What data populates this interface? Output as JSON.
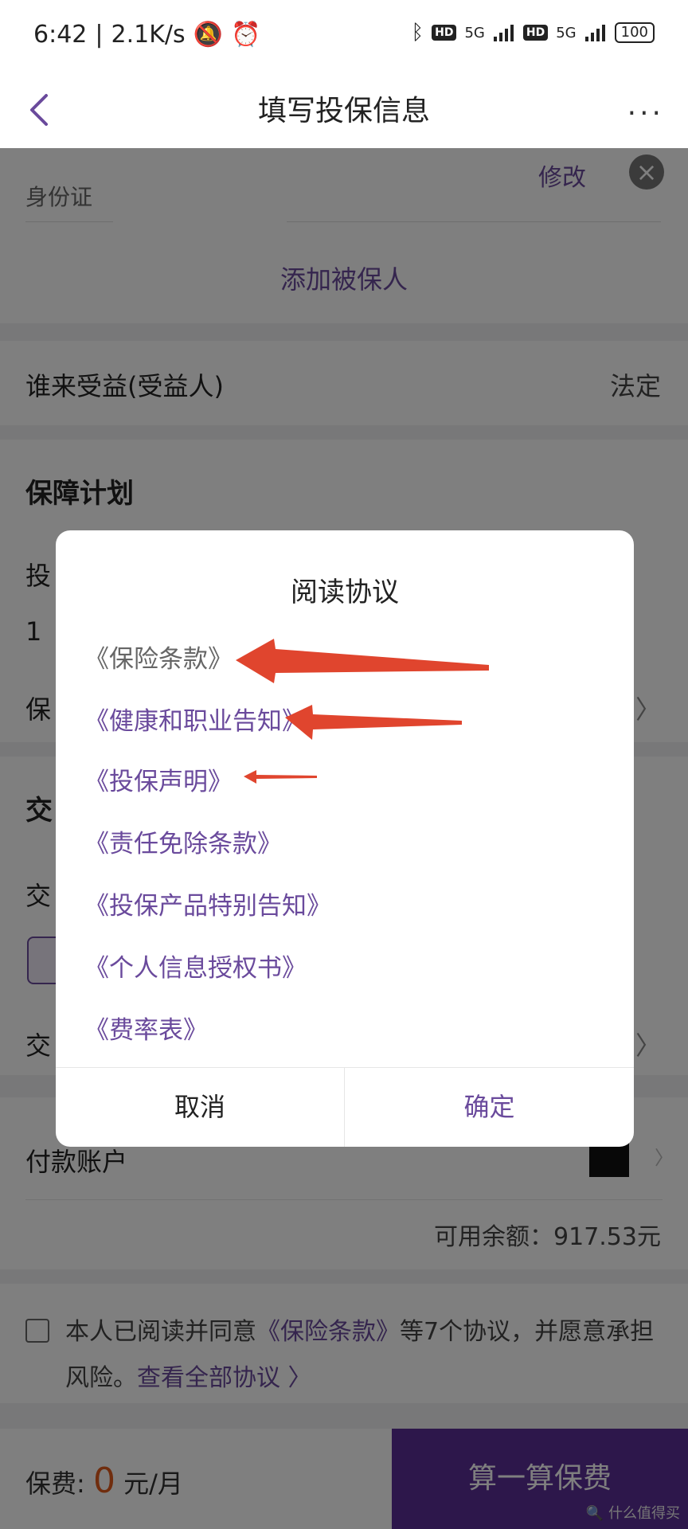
{
  "status_bar": {
    "time": "6:42",
    "speed": "2.1K/s",
    "hd1": "HD",
    "net1": "5G",
    "hd2": "HD",
    "net2": "5G",
    "battery": "100"
  },
  "nav": {
    "title": "填写投保信息",
    "more": "···"
  },
  "insured": {
    "id_label": "身份证",
    "edit_label": "修改",
    "add_label": "添加被保人"
  },
  "beneficiary": {
    "label": "谁来受益(受益人)",
    "value": "法定"
  },
  "plan": {
    "heading": "保障计划",
    "row1_partial": "投",
    "row2_partial": "1",
    "row3_partial": "保",
    "row3_right": "主 〉"
  },
  "trade": {
    "heading_partial": "交",
    "row1_partial": "交",
    "row2_partial": "交",
    "row2_right": "月 〉"
  },
  "payment": {
    "label": "付款账户",
    "balance": "可用余额：917.53元"
  },
  "agreement": {
    "prefix": "本人已阅读并同意",
    "link": "《保险条款》",
    "middle": "等7个协议，并愿意承担风险。",
    "view_all": "查看全部协议 〉"
  },
  "bottom": {
    "fee_label": "保费:",
    "fee_value": "0",
    "fee_unit": "元/月",
    "calc_button": "算一算保费",
    "watermark": "🔍 什么值得买"
  },
  "dialog": {
    "title": "阅读协议",
    "items": [
      "《保险条款》",
      "《健康和职业告知》",
      "《投保声明》",
      "《责任免除条款》",
      "《投保产品特别告知》",
      "《个人信息授权书》",
      "《费率表》"
    ],
    "cancel": "取消",
    "confirm": "确定"
  },
  "colors": {
    "accent": "#6a4a9c",
    "primary_button": "#5b2e96",
    "annotation_arrow": "#e0452e"
  }
}
